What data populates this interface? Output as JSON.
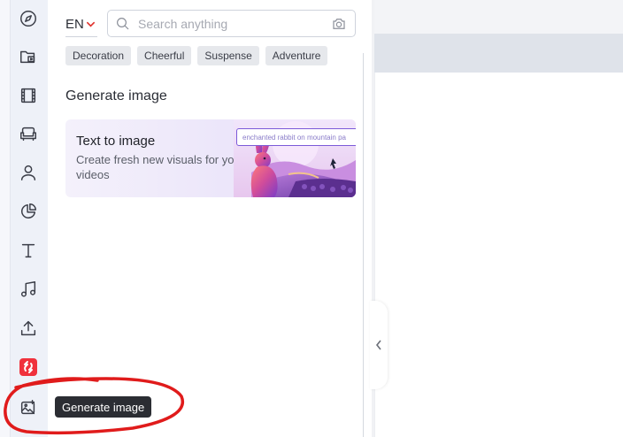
{
  "header": {
    "language": "EN",
    "search_placeholder": "Search anything"
  },
  "rail": {
    "items": [
      {
        "icon": "compass-icon"
      },
      {
        "icon": "folder-media-icon"
      },
      {
        "icon": "film-icon"
      },
      {
        "icon": "sofa-icon"
      },
      {
        "icon": "person-icon"
      },
      {
        "icon": "pie-chart-icon"
      },
      {
        "icon": "text-icon"
      },
      {
        "icon": "music-note-icon"
      },
      {
        "icon": "upload-icon"
      },
      {
        "icon": "brand-app-icon"
      },
      {
        "icon": "generate-image-icon"
      }
    ]
  },
  "tags": [
    "Decoration",
    "Cheerful",
    "Suspense",
    "Adventure"
  ],
  "section": {
    "title": "Generate image"
  },
  "card": {
    "title": "Text to image",
    "description": "Create fresh new visuals for your videos",
    "prompt_example": "enchanted rabbit on mountain pa"
  },
  "tooltip": {
    "label": "Generate image"
  },
  "colors": {
    "brand_red": "#f0313c",
    "accent_purple": "#7b5ad8",
    "annotation_red": "#e01b1b",
    "tooltip_bg": "#2b2d33"
  }
}
